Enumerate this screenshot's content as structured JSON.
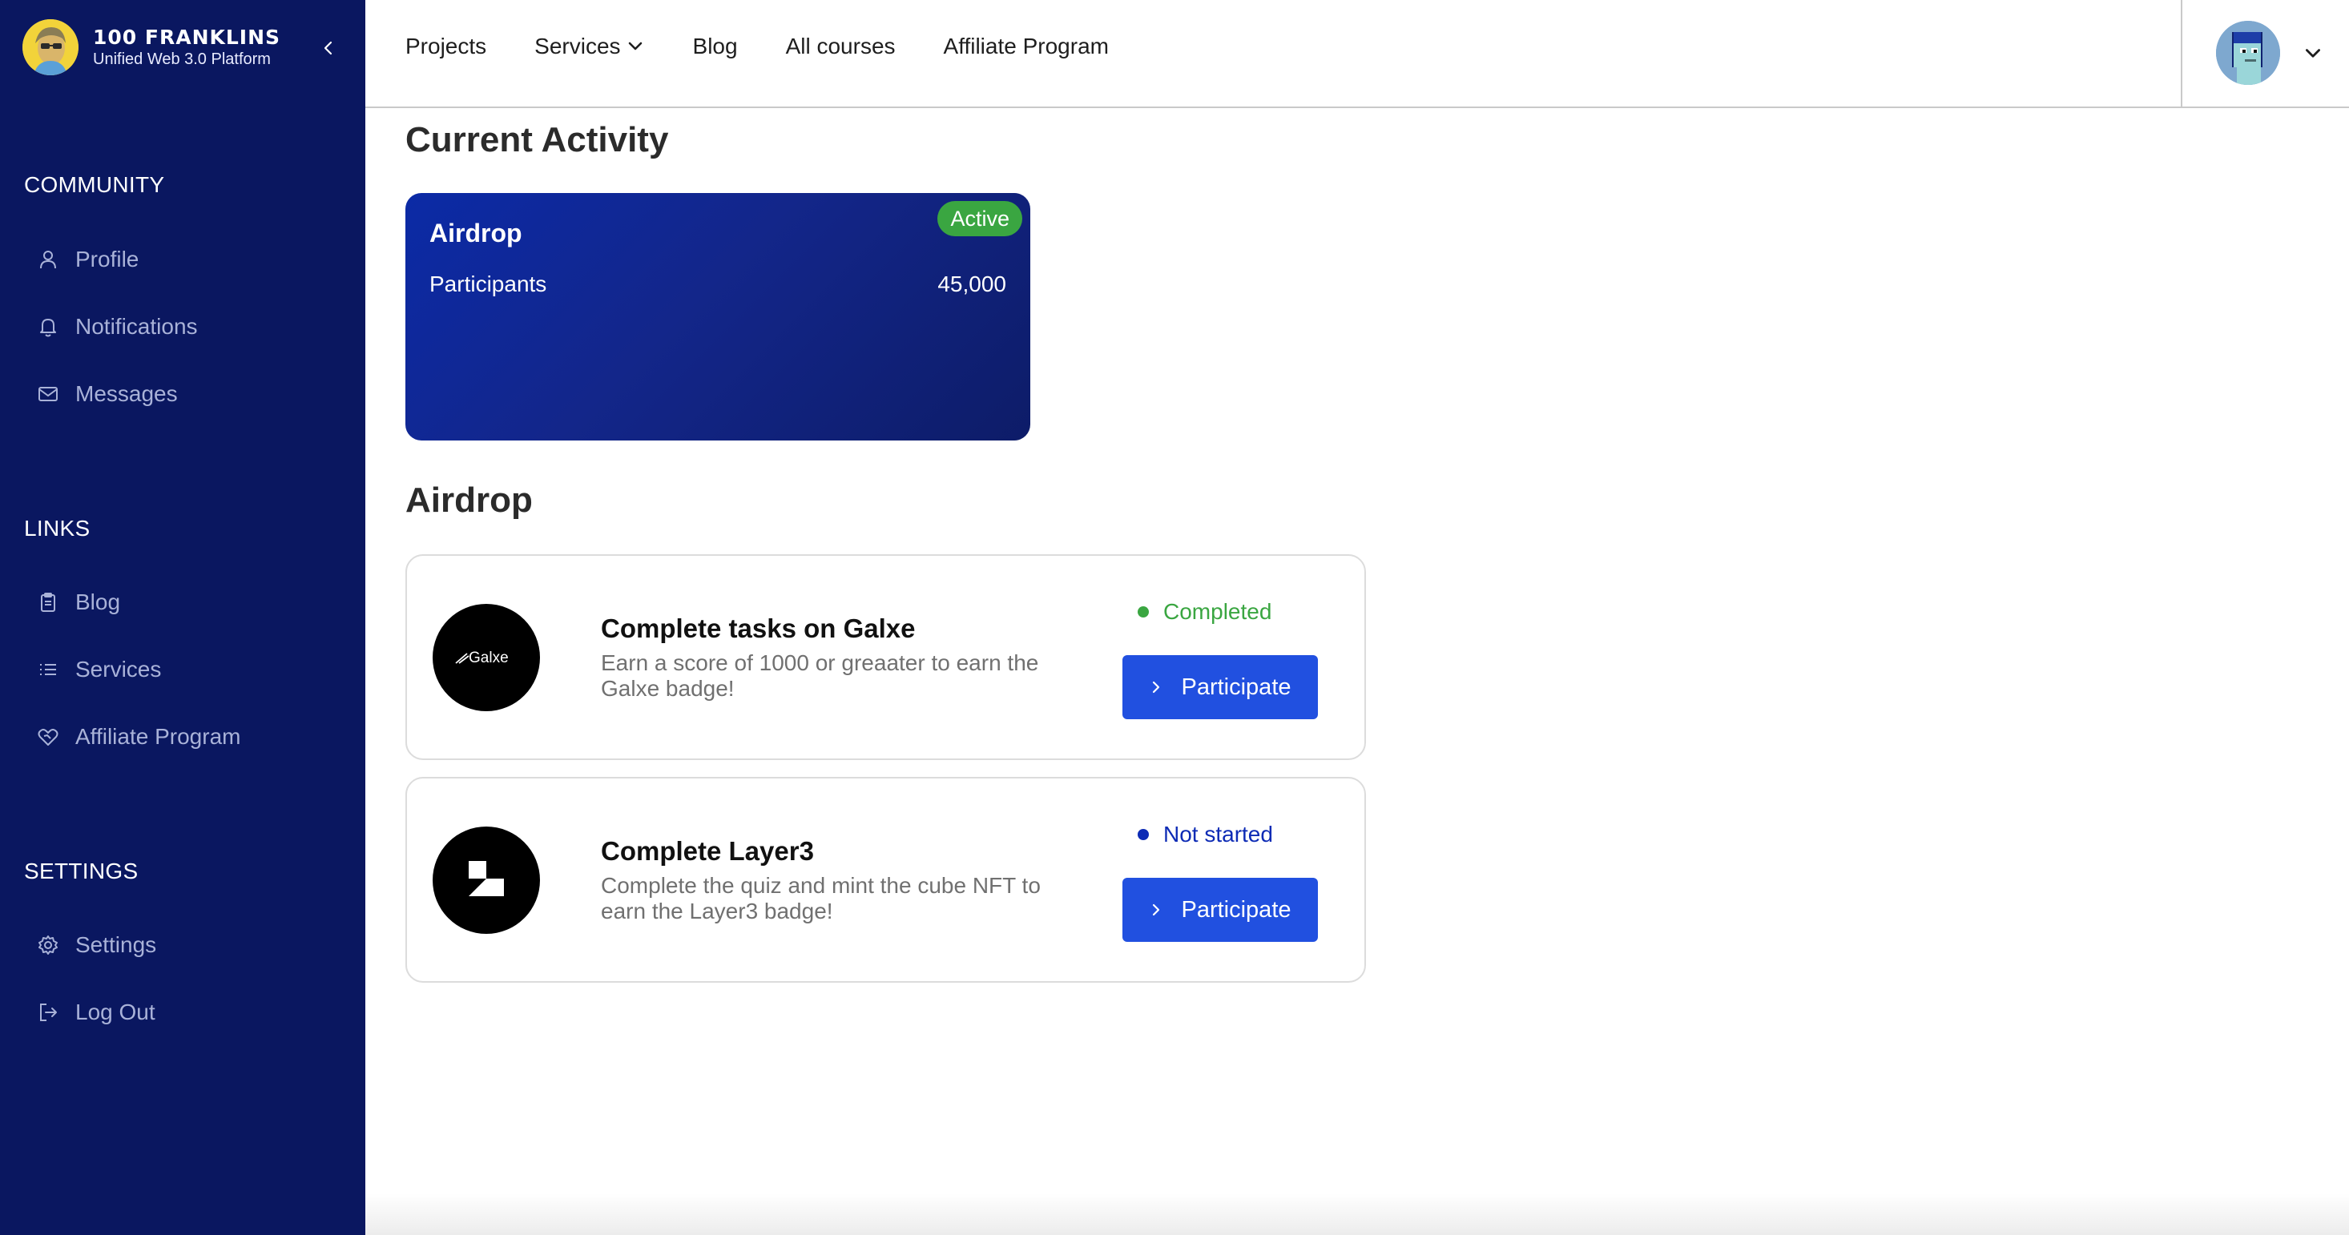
{
  "brand": {
    "name": "100 FRANKLINS",
    "subtitle": "Unified Web 3.0 Platform"
  },
  "sidebar": {
    "sections": [
      {
        "title": "COMMUNITY",
        "items": [
          {
            "label": "Profile",
            "icon": "user-icon"
          },
          {
            "label": "Notifications",
            "icon": "bell-icon"
          },
          {
            "label": "Messages",
            "icon": "mail-icon"
          }
        ]
      },
      {
        "title": "LINKS",
        "items": [
          {
            "label": "Blog",
            "icon": "clipboard-icon"
          },
          {
            "label": "Services",
            "icon": "list-icon"
          },
          {
            "label": "Affiliate Program",
            "icon": "heart-handshake-icon"
          }
        ]
      },
      {
        "title": "SETTINGS",
        "items": [
          {
            "label": "Settings",
            "icon": "gear-icon"
          },
          {
            "label": "Log Out",
            "icon": "logout-icon"
          }
        ]
      }
    ]
  },
  "topnav": {
    "items": [
      "Projects",
      "Services",
      "Blog",
      "All courses",
      "Affiliate Program"
    ]
  },
  "main": {
    "current_activity_heading": "Current Activity",
    "activity_card": {
      "title": "Airdrop",
      "status": "Active",
      "label": "Participants",
      "value": "45,000"
    },
    "airdrop_heading": "Airdrop",
    "tasks": [
      {
        "logo_text": "Galxe",
        "title": "Complete tasks on Galxe",
        "description": "Earn a score of 1000 or greaater to earn the Galxe badge!",
        "status": "Completed",
        "status_color": "#3aa641",
        "button": "Participate"
      },
      {
        "title": "Complete Layer3",
        "description": "Complete the quiz and mint the cube NFT to earn the Layer3 badge!",
        "status": "Not started",
        "status_color": "#0d2bb5",
        "button": "Participate"
      }
    ]
  },
  "colors": {
    "sidebar_bg": "#0a1760",
    "accent": "#2150e0",
    "success": "#3aa641"
  }
}
